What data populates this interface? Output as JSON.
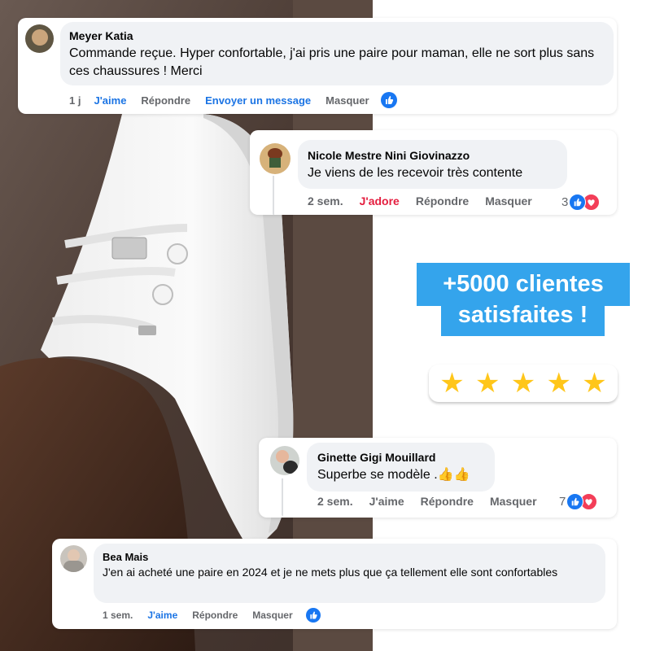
{
  "promo": {
    "line1": "+5000 clientes",
    "line2": "satisfaites !",
    "rating": 5,
    "stars": [
      "★",
      "★",
      "★",
      "★",
      "★"
    ]
  },
  "comments": [
    {
      "author": "Meyer Katia",
      "text": "Commande reçue. Hyper confortable, j'ai pris une paire pour maman, elle ne sort plus sans ces chaussures ! Merci",
      "time": "1 j",
      "like_label": "J'aime",
      "reply_label": "Répondre",
      "message_label": "Envoyer un message",
      "hide_label": "Masquer"
    },
    {
      "author": "Nicole Mestre Nini Giovinazzo",
      "text": "Je viens de les recevoir très contente",
      "time": "2 sem.",
      "like_label": "J'adore",
      "reply_label": "Répondre",
      "hide_label": "Masquer",
      "reaction_count": "3"
    },
    {
      "author": "Ginette Gigi Mouillard",
      "text": "Superbe se modèle .👍👍",
      "time": "2 sem.",
      "like_label": "J'aime",
      "reply_label": "Répondre",
      "hide_label": "Masquer",
      "reaction_count": "7"
    },
    {
      "author": "Bea Mais",
      "text": "J'en ai acheté une paire en 2024 et je ne mets plus que ça tellement elle sont confortables",
      "time": "1 sem.",
      "like_label": "J'aime",
      "reply_label": "Répondre",
      "hide_label": "Masquer"
    }
  ],
  "colors": {
    "promo_bg": "#34a4ec",
    "facebook_blue": "#1877f2",
    "love_red": "#f33e58",
    "star_yellow": "#ffc61a",
    "bubble_gray": "#f0f2f5"
  }
}
